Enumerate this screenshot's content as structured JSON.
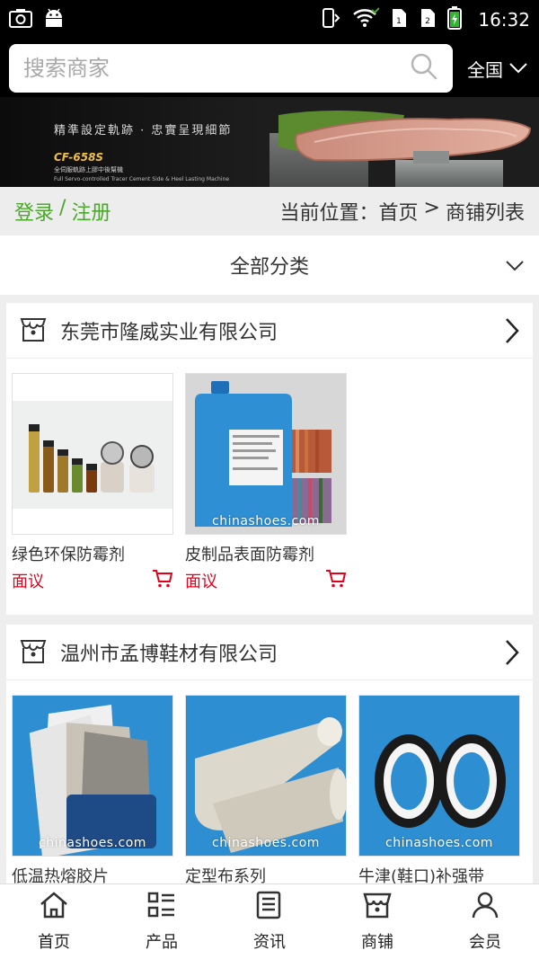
{
  "status_bar": {
    "time": "16:32",
    "left_icons": [
      "screenshot-icon",
      "android-icon"
    ],
    "right_icons": [
      "phone-vibrate-icon",
      "wifi-icon",
      "sim1-icon",
      "sim2-icon",
      "battery-charging-icon"
    ]
  },
  "header": {
    "search_placeholder": "搜索商家",
    "region_label": "全国"
  },
  "banner": {
    "slogan": "精準設定軌跡 · 忠實呈現細節",
    "model": "CF-658S",
    "subtitle": "全伺服軌跡上膠中後幫機",
    "subtitle_en": "Full Servo-controlled Tracer Cement Side & Heel Lasting Machine"
  },
  "breadcrumb": {
    "login": "登录",
    "separator": "/",
    "register": "注册",
    "location_label": "当前位置：",
    "home": "首页",
    "arrow": ">",
    "current": "商铺列表"
  },
  "category": {
    "label": "全部分类"
  },
  "shops": [
    {
      "name": "东莞市隆威实业有限公司",
      "products": [
        {
          "name": "绿色环保防霉剂",
          "price": "面议",
          "watermark": ""
        },
        {
          "name": "皮制品表面防霉剂",
          "price": "面议",
          "watermark": "chinashoes.com"
        }
      ]
    },
    {
      "name": "温州市孟博鞋材有限公司",
      "products": [
        {
          "name": "低温热熔胶片",
          "price": "",
          "watermark": "chinashoes.com"
        },
        {
          "name": "定型布系列",
          "price": "",
          "watermark": "chinashoes.com"
        },
        {
          "name": "牛津(鞋口)补强带",
          "price": "",
          "watermark": "chinashoes.com"
        }
      ]
    }
  ],
  "bottom_nav": {
    "items": [
      {
        "label": "首页",
        "icon": "home-icon"
      },
      {
        "label": "产品",
        "icon": "grid-list-icon"
      },
      {
        "label": "资讯",
        "icon": "news-icon"
      },
      {
        "label": "商铺",
        "icon": "shop-icon"
      },
      {
        "label": "会员",
        "icon": "user-icon"
      }
    ]
  },
  "colors": {
    "accent_green": "#4aa82a",
    "price_red": "#e2001a",
    "header_bg": "#000000"
  }
}
